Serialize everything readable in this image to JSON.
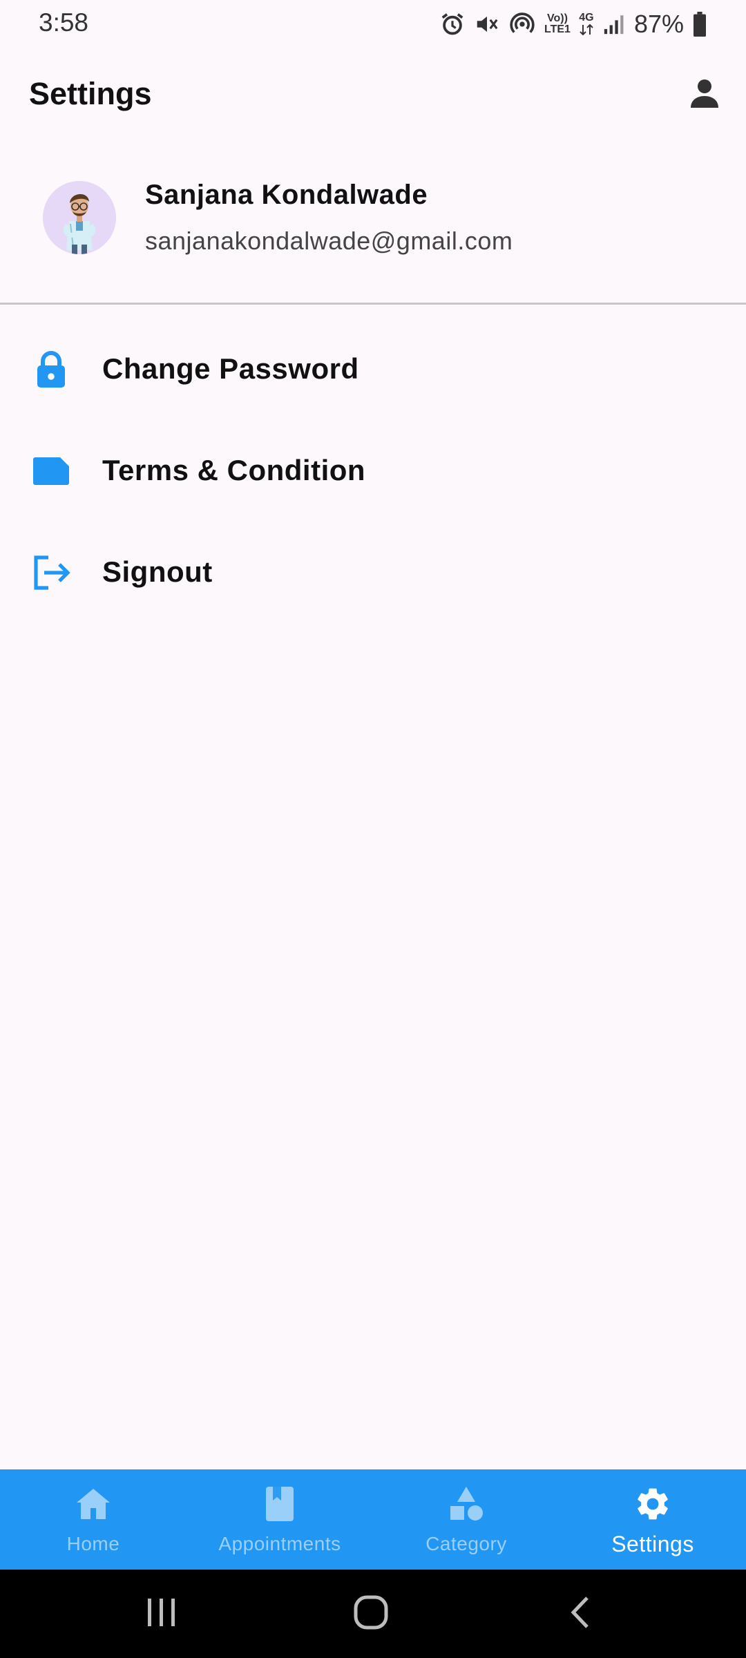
{
  "status_bar": {
    "time": "3:58",
    "battery": "87%",
    "volte_top": "Vo))",
    "volte_bottom": "LTE1",
    "network": "4G",
    "icons": [
      "alarm-icon",
      "mute-icon",
      "hotspot-icon",
      "volte-icon",
      "4g-icon",
      "signal-icon",
      "battery-icon"
    ]
  },
  "app_bar": {
    "title": "Settings",
    "action_icon": "person-icon"
  },
  "profile": {
    "name": "Sanjana Kondalwade",
    "email": "sanjanakondalwade@gmail.com",
    "avatar_icon": "doctor-avatar"
  },
  "menu": {
    "items": [
      {
        "label": "Change Password",
        "icon": "lock-icon"
      },
      {
        "label": "Terms & Condition",
        "icon": "document-icon"
      },
      {
        "label": "Signout",
        "icon": "logout-icon"
      }
    ]
  },
  "bottom_nav": {
    "items": [
      {
        "label": "Home",
        "icon": "home-icon"
      },
      {
        "label": "Appointments",
        "icon": "book-icon"
      },
      {
        "label": "Category",
        "icon": "category-icon"
      },
      {
        "label": "Settings",
        "icon": "gear-icon"
      }
    ],
    "active": "Settings"
  },
  "colors": {
    "primary": "#2196f3",
    "background": "#fdf8fc",
    "system_nav": "#000000"
  }
}
